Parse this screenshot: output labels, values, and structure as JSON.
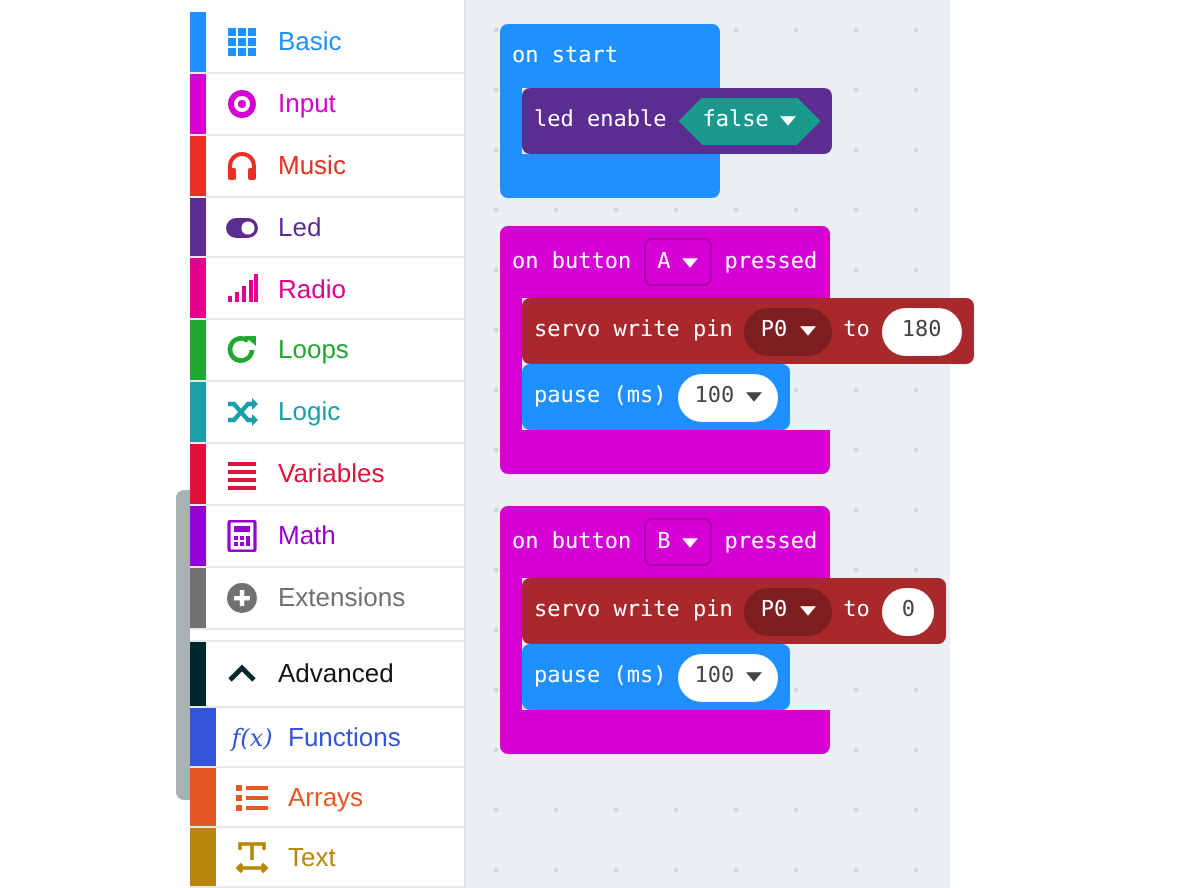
{
  "toolbox": {
    "categories": [
      {
        "label": "Basic",
        "kind": "grid",
        "color": "#1e90ff"
      },
      {
        "label": "Input",
        "kind": "target",
        "color": "#d400d4"
      },
      {
        "label": "Music",
        "kind": "headphones",
        "color": "#e63022"
      },
      {
        "label": "Led",
        "kind": "toggle",
        "color": "#5c2d91"
      },
      {
        "label": "Radio",
        "kind": "signal",
        "color": "#e3008c"
      },
      {
        "label": "Loops",
        "kind": "loop",
        "color": "#20a830"
      },
      {
        "label": "Logic",
        "kind": "shuffle",
        "color": "#1aa0a6"
      },
      {
        "label": "Variables",
        "kind": "lines",
        "color": "#dc143c"
      },
      {
        "label": "Math",
        "kind": "calculator",
        "color": "#9400d3"
      },
      {
        "label": "Extensions",
        "kind": "plus",
        "color": "#717171"
      }
    ],
    "advanced": {
      "label": "Advanced",
      "expanded": true,
      "color": "#00272b",
      "children": [
        {
          "label": "Functions",
          "kind": "function",
          "icon_text": "f(x)",
          "color": "#3455db"
        },
        {
          "label": "Arrays",
          "kind": "list",
          "color": "#e65722"
        },
        {
          "label": "Text",
          "kind": "text",
          "color": "#b8860b"
        }
      ]
    }
  },
  "workspace": {
    "blocks": [
      {
        "header": [
          {
            "kind": "text",
            "text": "on start"
          }
        ],
        "color": "#1e90ff",
        "body": [
          {
            "color": "#5c2d91",
            "parts": [
              {
                "kind": "text",
                "text": "led enable"
              },
              {
                "kind": "bool",
                "text": "false",
                "color": "#1a9a8e"
              }
            ]
          }
        ]
      },
      {
        "header": [
          {
            "kind": "text",
            "text": "on button"
          },
          {
            "kind": "menu",
            "text": "A"
          },
          {
            "kind": "text",
            "text": "pressed"
          }
        ],
        "color": "#d400d4",
        "body": [
          {
            "color": "#a8282c",
            "parts": [
              {
                "kind": "text",
                "text": "servo write pin"
              },
              {
                "kind": "pin",
                "text": "P0"
              },
              {
                "kind": "text",
                "text": "to"
              },
              {
                "kind": "number",
                "text": "180"
              }
            ]
          },
          {
            "color": "#1e90ff",
            "parts": [
              {
                "kind": "text",
                "text": "pause (ms)"
              },
              {
                "kind": "numdrop",
                "text": "100"
              }
            ]
          }
        ]
      },
      {
        "header": [
          {
            "kind": "text",
            "text": "on button"
          },
          {
            "kind": "menu",
            "text": "B"
          },
          {
            "kind": "text",
            "text": "pressed"
          }
        ],
        "color": "#d400d4",
        "body": [
          {
            "color": "#a8282c",
            "parts": [
              {
                "kind": "text",
                "text": "servo write pin"
              },
              {
                "kind": "pin",
                "text": "P0"
              },
              {
                "kind": "text",
                "text": "to"
              },
              {
                "kind": "number",
                "text": "0"
              }
            ]
          },
          {
            "color": "#1e90ff",
            "parts": [
              {
                "kind": "text",
                "text": "pause (ms)"
              },
              {
                "kind": "numdrop",
                "text": "100"
              }
            ]
          }
        ]
      }
    ]
  }
}
